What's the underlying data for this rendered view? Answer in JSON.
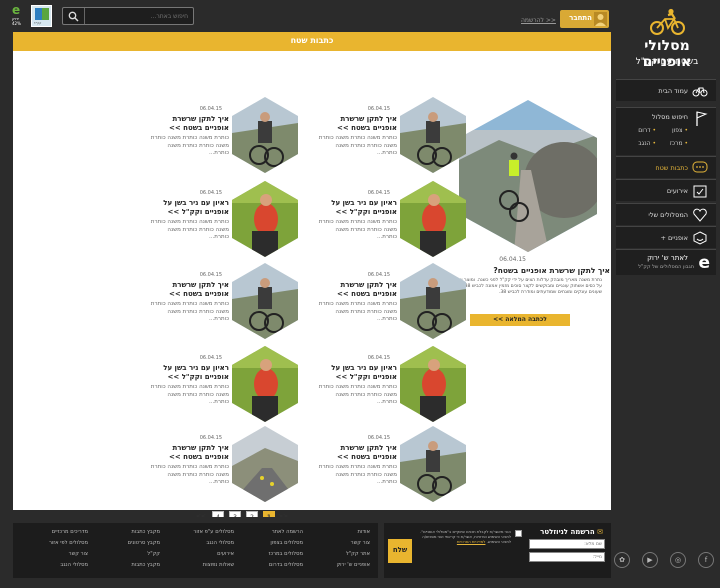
{
  "header": {
    "search_placeholder": "חיפוש באתר...",
    "register_link": "להרשמה >>",
    "login_label": "התחבר",
    "eco_sub": "ירוק",
    "eco_pct": "42%",
    "kkl_label": "קק\"ל"
  },
  "logo": {
    "line1": "מסלולי אופניים",
    "line2": "בשטח עם קק\"ל"
  },
  "nav": {
    "home": "עמוד הבית",
    "route_search": "חיפוש מסלול",
    "regions": [
      "צפון",
      "דרום",
      "מרכז",
      "הנגב"
    ],
    "articles": "כתבות שטח",
    "events": "אירועים",
    "favorites": "המסלולים שלי",
    "bikes_plus": "אופניים +",
    "ramer_title": "לאתר ש' ירוק",
    "ramer_sub": "תגבון המסלולים של קק\"ל"
  },
  "main": {
    "title": "כתבות שטח",
    "featured": {
      "date": "06.04.15",
      "title": "איך לתקן שרשרת אופניים בשטח?",
      "body": "נתרת משנה מאריך מובהק עדלות הצים על ידי קק\"ל לפני כשנה. ומוצר ואתם, על כסים אשתוק עונגיים ומבוקשים לקצר סוכים מזמין אמונה לכביש 38. שעונים עונקים ומוגחים שמודעתים ומודרת לכביש 38.",
      "more": "לכתבה המלאה >>"
    },
    "cards": [
      {
        "date": "06.04.15",
        "title": "איך לתקן שרשרת אופניים בשטח >>",
        "body": "כותרת משנה כותרת משנה כותרת משנה כותרת כותרת משנה כותרת..."
      },
      {
        "date": "06.04.15",
        "title": "איך לתקן שרשרת אופניים בשטח >>",
        "body": "כותרת משנה כותרת משנה כותרת משנה כותרת כותרת משנה כותרת..."
      },
      {
        "date": "06.04.15",
        "title": "ראיון עם ניר בשן על אופניים וקק\"ל >>",
        "body": "כותרת משנה כותרת משנה כותרת משנה כותרת כותרת משנה כותרת..."
      },
      {
        "date": "06.04.15",
        "title": "ראיון עם ניר בשן על אופניים וקק\"ל >>",
        "body": "כותרת משנה כותרת משנה כותרת משנה כותרת כותרת משנה כותרת..."
      },
      {
        "date": "06.04.15",
        "title": "איך לתקן שרשרת אופניים בשטח >>",
        "body": "כותרת משנה כותרת משנה כותרת משנה כותרת כותרת משנה כותרת..."
      },
      {
        "date": "06.04.15",
        "title": "איך לתקן שרשרת אופניים בשטח >>",
        "body": "כותרת משנה כותרת משנה כותרת משנה כותרת כותרת משנה כותרת..."
      },
      {
        "date": "06.04.15",
        "title": "ראיון עם ניר בשן על אופניים וקק\"ל >>",
        "body": "כותרת משנה כותרת משנה כותרת משנה כותרת כותרת משנה כותרת..."
      },
      {
        "date": "06.04.15",
        "title": "ראיון עם ניר בשן על אופניים וקק\"ל >>",
        "body": "כותרת משנה כותרת משנה כותרת משנה כותרת כותרת משנה כותרת..."
      },
      {
        "date": "06.04.15",
        "title": "איך לתקן שרשרת אופניים בשטח >>",
        "body": "כותרת משנה כותרת משנה כותרת משנה כותרת כותרת משנה כותרת..."
      },
      {
        "date": "06.04.15",
        "title": "איך לתקן שרשרת אופניים בשטח >>",
        "body": "כותרת משנה כותרת משנה כותרת משנה כותרת כותרת משנה כותרת..."
      }
    ],
    "pager": {
      "prev": "<<",
      "pages": [
        "1",
        "2",
        "3",
        "4"
      ],
      "next": ">>"
    }
  },
  "footer": {
    "newsletter_title": "הרשמה לניוזלטר",
    "name_placeholder": "שם מלא:",
    "email_placeholder": "מייל:",
    "send": "שלח",
    "note": "הנני מאשר/ת לקבלת תכנים שיווקיים ב\"מסלולי אופניים\". לתנאי השימוש ופרטיות, אשר/ת כי קראתי ואני מסכים/ה לתנאי השימוש.",
    "note_link": "למדיניות הפרטיות",
    "cols": [
      [
        "אודות",
        "צור קשר",
        "אתר קק\"ל",
        "אופניים ש' ירוק"
      ],
      [
        "הרשמה לאתר",
        "מסלולים בצפון",
        "מסלולים במרכז",
        "מסלולים בדרום"
      ],
      [
        "מסלולים ע\"פ אזור",
        "מסלולי הנגב",
        "אירועים",
        "שאלות נפוצות"
      ],
      [
        "מקבץ כתבות",
        "מקבץ סרטונים",
        "קק\"ל",
        "מקבץ כתבות"
      ],
      [
        "מדריכים מרכזיים",
        "מסלולים לפי אזור",
        "צור קשר",
        "מסלולי הנגב"
      ]
    ],
    "social": [
      "facebook",
      "instagram",
      "youtube",
      "kkl"
    ]
  }
}
